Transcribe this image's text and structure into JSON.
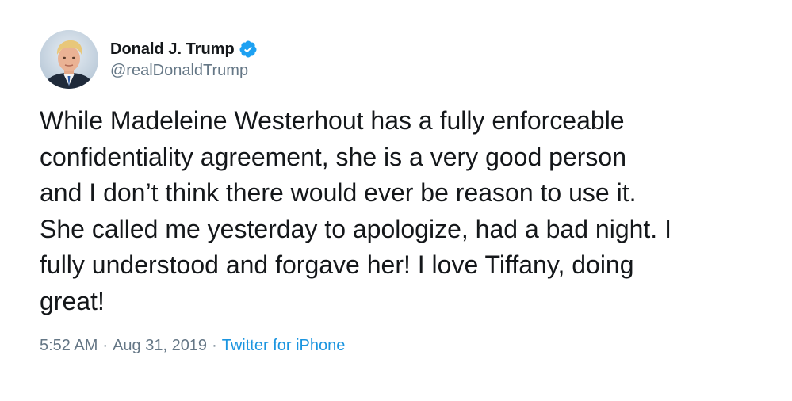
{
  "author": {
    "display_name": "Donald J. Trump",
    "handle": "@realDonaldTrump",
    "verified": true,
    "verified_color": "#1da1f2",
    "avatar_icon": "profile-photo"
  },
  "tweet": {
    "lines": [
      "While Madeleine Westerhout has a fully enforceable",
      "confidentiality agreement, she is a very good person",
      "and I don’t think there would ever be reason to use it.",
      "She called me yesterday to apologize, had a bad night. I",
      "fully understood and forgave her! I love Tiffany, doing",
      "great!"
    ]
  },
  "meta": {
    "time": "5:52 AM",
    "separator": "·",
    "date": "Aug 31, 2019",
    "source": "Twitter for iPhone",
    "link_color": "#1b95e0",
    "muted_color": "#657786"
  }
}
